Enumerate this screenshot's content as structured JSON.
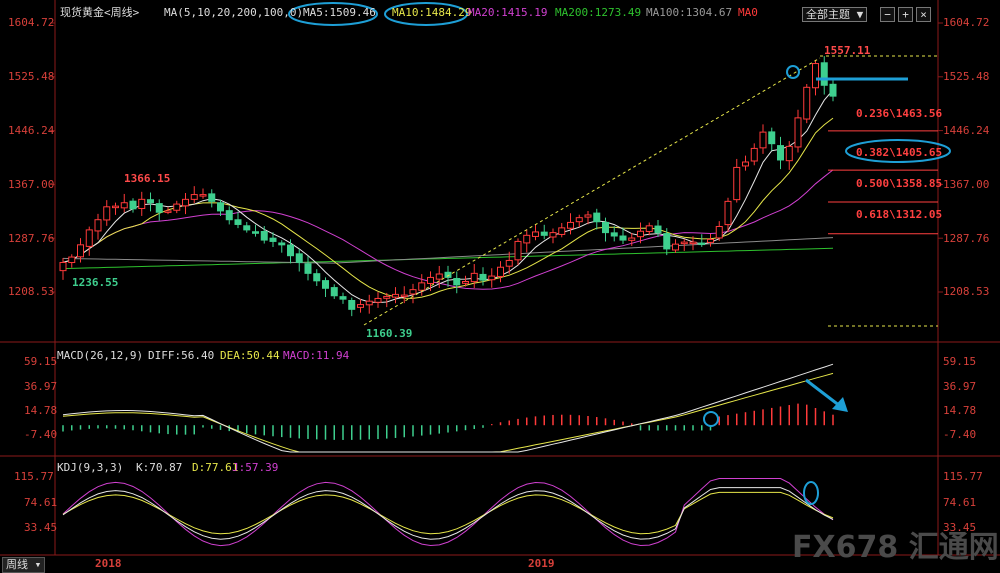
{
  "header": {
    "instrument": "现货黄金<周线>",
    "ma_params": "MA(5,10,20,200,100,0)",
    "ma5": "MA5:1509.46",
    "ma10": "MA10:1484.29",
    "ma20": "MA20:1415.19",
    "ma200": "MA200:1273.49",
    "ma100": "MA100:1304.67",
    "ma0": "MA0",
    "toolbar_label": "全部主题"
  },
  "macd_header": {
    "params": "MACD(26,12,9)",
    "diff": "DIFF:56.40",
    "dea": "DEA:50.44",
    "macd": "MACD:11.94"
  },
  "kdj_header": {
    "params": "KDJ(9,3,3)",
    "k": "K:70.87",
    "d": "D:77.61",
    "j": "J:57.39"
  },
  "footer": {
    "period_label": "周线",
    "watermark": "FX678 汇通网"
  },
  "colors": {
    "up": "#ff3a3a",
    "down": "#3ecf8e",
    "ma5": "#e6e6e6",
    "ma10": "#e6e64a",
    "ma20": "#d040d0",
    "ma100": "#8a8a8a",
    "ma200": "#2ec22e",
    "annot": "#1e9fd6",
    "fib": "#ff4040"
  },
  "chart_data": [
    {
      "type": "candlestick",
      "title": "现货黄金<周线>",
      "ylabel": "",
      "ylim": [
        1160,
        1604.72
      ],
      "y_ticks": [
        "1604.72",
        "1525.48",
        "1446.24",
        "1367.00",
        "1287.76",
        "1208.53"
      ],
      "x_labels": [
        "2018",
        "2019"
      ],
      "annotations": [
        "1366.15",
        "1236.55",
        "1160.39",
        "1557.11"
      ],
      "fib_levels": [
        {
          "label": "0.236\\1463.56",
          "value": 1463.56
        },
        {
          "label": "0.382\\1405.65",
          "value": 1405.65
        },
        {
          "label": "0.500\\1358.85",
          "value": 1358.85
        },
        {
          "label": "0.618\\1312.05",
          "value": 1312.05
        }
      ],
      "close": [
        1252,
        1260,
        1278,
        1300,
        1315,
        1334,
        1335,
        1340,
        1331,
        1345,
        1340,
        1326,
        1328,
        1338,
        1345,
        1352,
        1352,
        1342,
        1328,
        1315,
        1308,
        1300,
        1295,
        1285,
        1283,
        1278,
        1262,
        1252,
        1236,
        1225,
        1214,
        1203,
        1198,
        1183,
        1190,
        1195,
        1199,
        1202,
        1205,
        1204,
        1212,
        1222,
        1230,
        1235,
        1230,
        1219,
        1224,
        1236,
        1226,
        1232,
        1245,
        1255,
        1283,
        1292,
        1297,
        1292,
        1296,
        1303,
        1311,
        1318,
        1322,
        1312,
        1296,
        1291,
        1285,
        1288,
        1298,
        1306,
        1296,
        1272,
        1279,
        1282,
        1282,
        1280,
        1286,
        1305,
        1342,
        1392,
        1400,
        1420,
        1444,
        1427,
        1403,
        1423,
        1465,
        1510,
        1545,
        1513,
        1497
      ],
      "ma5_last": 1509.46,
      "ma10_last": 1484.29,
      "ma20_last": 1415.19,
      "ma100_last": 1304.67,
      "ma200_last": 1273.49
    },
    {
      "type": "line",
      "title": "MACD(26,12,9)",
      "series_names": [
        "DIFF",
        "DEA",
        "MACD"
      ],
      "y_ticks": [
        "59.15",
        "36.97",
        "14.78",
        "-7.40"
      ],
      "ylim": [
        -15,
        60
      ],
      "last": {
        "DIFF": 56.4,
        "DEA": 50.44,
        "MACD": 11.94
      }
    },
    {
      "type": "line",
      "title": "KDJ(9,3,3)",
      "series_names": [
        "K",
        "D",
        "J"
      ],
      "y_ticks": [
        "115.77",
        "74.61",
        "33.45"
      ],
      "ylim": [
        0,
        120
      ],
      "last": {
        "K": 70.87,
        "D": 77.61,
        "J": 57.39
      }
    }
  ]
}
